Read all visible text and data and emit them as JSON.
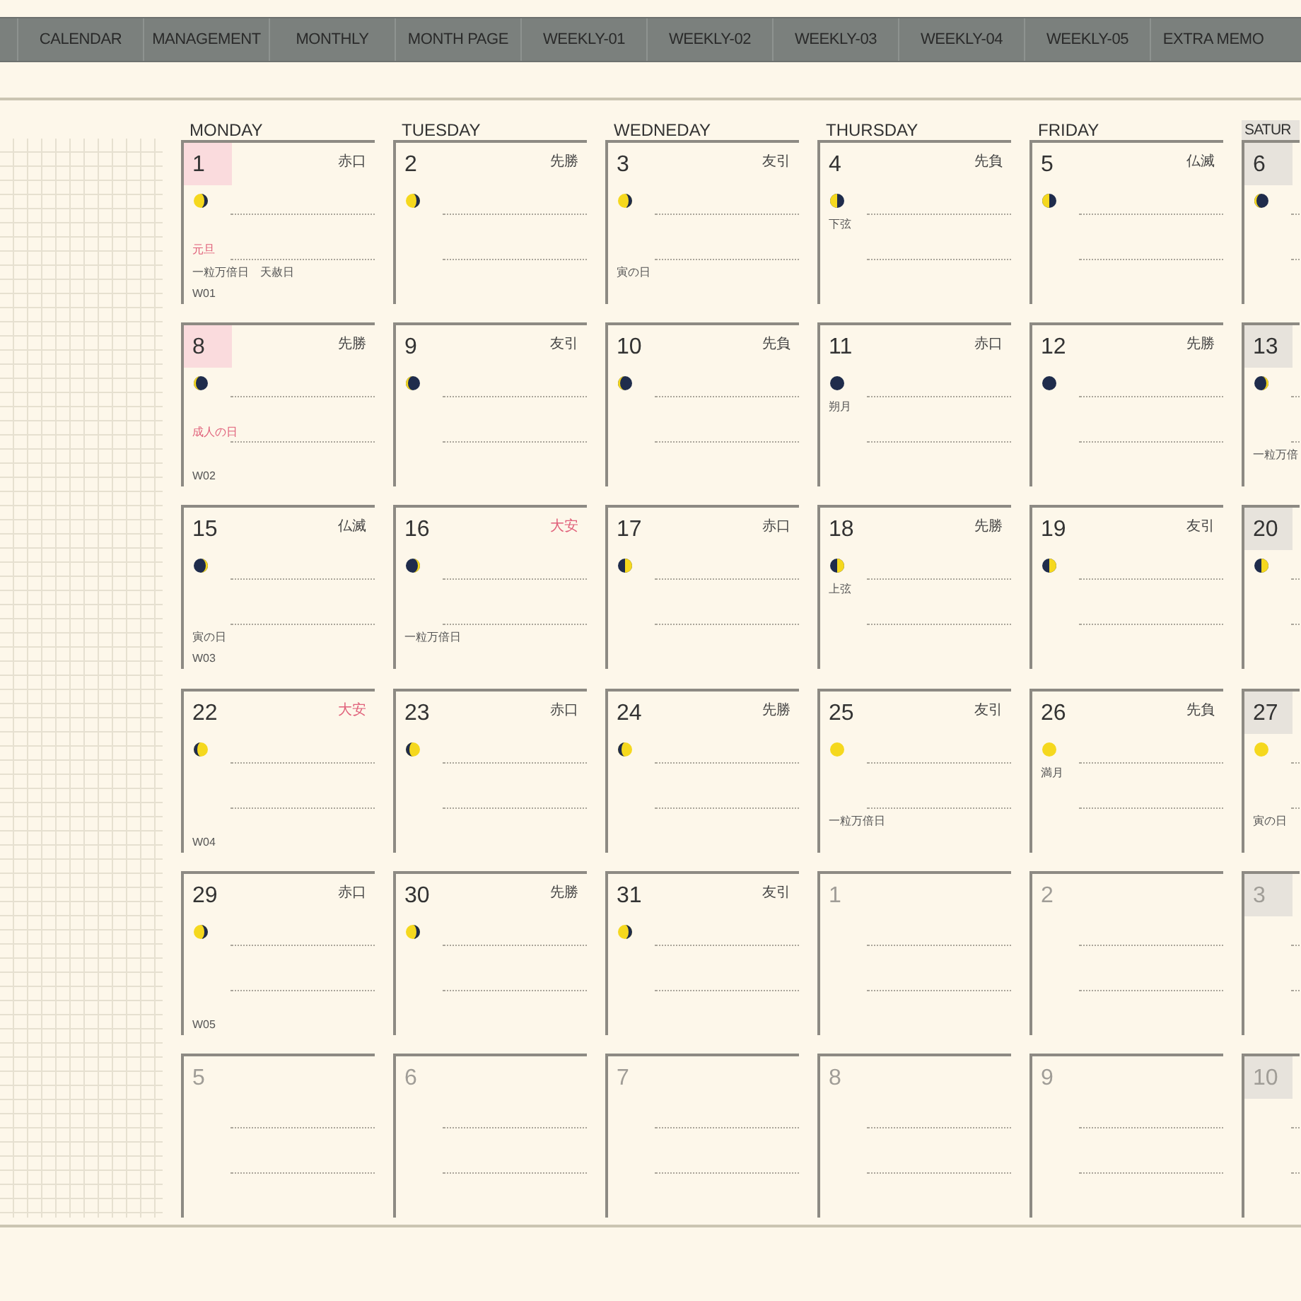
{
  "tabs": [
    {
      "label": "CALENDAR",
      "selected": false
    },
    {
      "label": "MANAGEMENT",
      "selected": false
    },
    {
      "label": "MONTHLY",
      "selected": false
    },
    {
      "label": "MONTH PAGE",
      "selected": false
    },
    {
      "label": "WEEKLY-01",
      "selected": false
    },
    {
      "label": "WEEKLY-02",
      "selected": false
    },
    {
      "label": "WEEKLY-03",
      "selected": false
    },
    {
      "label": "WEEKLY-04",
      "selected": false
    },
    {
      "label": "WEEKLY-05",
      "selected": false
    },
    {
      "label": "EXTRA MEMO",
      "selected": false
    }
  ],
  "weekdays": [
    {
      "label": "MONDAY",
      "saturday": false
    },
    {
      "label": "TUESDAY",
      "saturday": false
    },
    {
      "label": "WEDNEDAY",
      "saturday": false
    },
    {
      "label": "THURSDAY",
      "saturday": false
    },
    {
      "label": "FRIDAY",
      "saturday": false
    },
    {
      "label": "SATUR",
      "saturday": true
    }
  ],
  "weeks": [
    {
      "days": [
        {
          "number": "1",
          "rokuyo": "赤口",
          "rokuyo_red": false,
          "kind": "holiday",
          "other_month": false,
          "moon": {
            "kind": "left-gibbous"
          },
          "holiday": "元旦",
          "notes": "一粒万倍日　天赦日",
          "week": "W01"
        },
        {
          "number": "2",
          "rokuyo": "先勝",
          "rokuyo_red": false,
          "kind": "plain",
          "other_month": false,
          "moon": {
            "kind": "left-gibbous"
          }
        },
        {
          "number": "3",
          "rokuyo": "友引",
          "rokuyo_red": false,
          "kind": "plain",
          "other_month": false,
          "moon": {
            "kind": "left-gibbous"
          },
          "notes": "寅の日"
        },
        {
          "number": "4",
          "rokuyo": "先負",
          "rokuyo_red": false,
          "kind": "plain",
          "other_month": false,
          "moon": {
            "kind": "left-half"
          },
          "moon_note": "下弦"
        },
        {
          "number": "5",
          "rokuyo": "仏滅",
          "rokuyo_red": false,
          "kind": "plain",
          "other_month": false,
          "moon": {
            "kind": "left-half"
          }
        },
        {
          "number": "6",
          "kind": "saturday",
          "other_month": false,
          "moon": {
            "kind": "left-crescent"
          }
        }
      ]
    },
    {
      "days": [
        {
          "number": "8",
          "rokuyo": "先勝",
          "rokuyo_red": false,
          "kind": "holiday",
          "other_month": false,
          "moon": {
            "kind": "left-crescent"
          },
          "holiday": "成人の日",
          "week": "W02"
        },
        {
          "number": "9",
          "rokuyo": "友引",
          "rokuyo_red": false,
          "kind": "plain",
          "other_month": false,
          "moon": {
            "kind": "left-crescent"
          }
        },
        {
          "number": "10",
          "rokuyo": "先負",
          "rokuyo_red": false,
          "kind": "plain",
          "other_month": false,
          "moon": {
            "kind": "left-crescent"
          }
        },
        {
          "number": "11",
          "rokuyo": "赤口",
          "rokuyo_red": false,
          "kind": "plain",
          "other_month": false,
          "moon": {
            "kind": "new"
          },
          "moon_note": "朔月"
        },
        {
          "number": "12",
          "rokuyo": "先勝",
          "rokuyo_red": false,
          "kind": "plain",
          "other_month": false,
          "moon": {
            "kind": "new"
          }
        },
        {
          "number": "13",
          "kind": "saturday",
          "other_month": false,
          "moon": {
            "kind": "right-crescent"
          },
          "notes": "一粒万倍"
        }
      ]
    },
    {
      "days": [
        {
          "number": "15",
          "rokuyo": "仏滅",
          "rokuyo_red": false,
          "kind": "plain",
          "other_month": false,
          "moon": {
            "kind": "right-crescent"
          },
          "notes": "寅の日",
          "week": "W03"
        },
        {
          "number": "16",
          "rokuyo": "大安",
          "rokuyo_red": true,
          "kind": "plain",
          "other_month": false,
          "moon": {
            "kind": "right-crescent"
          },
          "notes": "一粒万倍日"
        },
        {
          "number": "17",
          "rokuyo": "赤口",
          "rokuyo_red": false,
          "kind": "plain",
          "other_month": false,
          "moon": {
            "kind": "right-half"
          }
        },
        {
          "number": "18",
          "rokuyo": "先勝",
          "rokuyo_red": false,
          "kind": "plain",
          "other_month": false,
          "moon": {
            "kind": "right-half"
          },
          "moon_note": "上弦"
        },
        {
          "number": "19",
          "rokuyo": "友引",
          "rokuyo_red": false,
          "kind": "plain",
          "other_month": false,
          "moon": {
            "kind": "right-half"
          }
        },
        {
          "number": "20",
          "kind": "saturday",
          "other_month": false,
          "moon": {
            "kind": "right-half"
          }
        }
      ]
    },
    {
      "days": [
        {
          "number": "22",
          "rokuyo": "大安",
          "rokuyo_red": true,
          "kind": "plain",
          "other_month": false,
          "moon": {
            "kind": "right-gibbous"
          },
          "week": "W04"
        },
        {
          "number": "23",
          "rokuyo": "赤口",
          "rokuyo_red": false,
          "kind": "plain",
          "other_month": false,
          "moon": {
            "kind": "right-gibbous"
          }
        },
        {
          "number": "24",
          "rokuyo": "先勝",
          "rokuyo_red": false,
          "kind": "plain",
          "other_month": false,
          "moon": {
            "kind": "right-gibbous"
          }
        },
        {
          "number": "25",
          "rokuyo": "友引",
          "rokuyo_red": false,
          "kind": "plain",
          "other_month": false,
          "moon": {
            "kind": "full"
          },
          "notes": "一粒万倍日"
        },
        {
          "number": "26",
          "rokuyo": "先負",
          "rokuyo_red": false,
          "kind": "plain",
          "other_month": false,
          "moon": {
            "kind": "full"
          },
          "moon_note": "満月"
        },
        {
          "number": "27",
          "kind": "saturday",
          "other_month": false,
          "moon": {
            "kind": "full"
          },
          "notes": "寅の日"
        }
      ]
    },
    {
      "days": [
        {
          "number": "29",
          "rokuyo": "赤口",
          "rokuyo_red": false,
          "kind": "plain",
          "other_month": false,
          "moon": {
            "kind": "left-gibbous"
          },
          "week": "W05"
        },
        {
          "number": "30",
          "rokuyo": "先勝",
          "rokuyo_red": false,
          "kind": "plain",
          "other_month": false,
          "moon": {
            "kind": "left-gibbous"
          }
        },
        {
          "number": "31",
          "rokuyo": "友引",
          "rokuyo_red": false,
          "kind": "plain",
          "other_month": false,
          "moon": {
            "kind": "left-gibbous"
          }
        },
        {
          "number": "1",
          "kind": "plain",
          "other_month": true
        },
        {
          "number": "2",
          "kind": "plain",
          "other_month": true
        },
        {
          "number": "3",
          "kind": "saturday",
          "other_month": true
        }
      ]
    },
    {
      "days": [
        {
          "number": "5",
          "kind": "plain",
          "other_month": true
        },
        {
          "number": "6",
          "kind": "plain",
          "other_month": true
        },
        {
          "number": "7",
          "kind": "plain",
          "other_month": true
        },
        {
          "number": "8",
          "kind": "plain",
          "other_month": true
        },
        {
          "number": "9",
          "kind": "plain",
          "other_month": true
        },
        {
          "number": "10",
          "kind": "saturday",
          "other_month": true
        }
      ]
    }
  ]
}
